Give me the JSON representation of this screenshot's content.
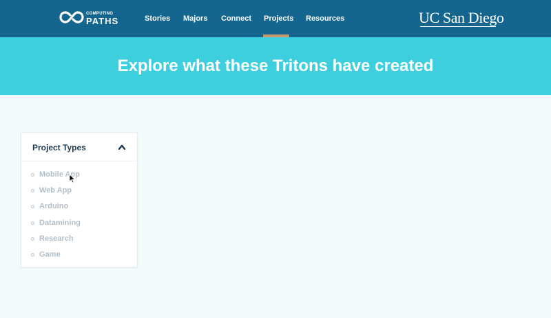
{
  "header": {
    "logo": {
      "top_text": "COMPUTING",
      "bottom_text": "PATHS",
      "icon": "infinity-loop-logo-icon"
    },
    "nav": [
      {
        "label": "Stories",
        "active": false
      },
      {
        "label": "Majors",
        "active": false
      },
      {
        "label": "Connect",
        "active": false
      },
      {
        "label": "Projects",
        "active": true
      },
      {
        "label": "Resources",
        "active": false
      }
    ],
    "brand": "UC San Diego",
    "colors": {
      "bar": "#15668f",
      "active_indicator": "#c69a6d"
    }
  },
  "hero": {
    "title": "Explore what these Tritons have created",
    "color": "#3ecfdf"
  },
  "filter": {
    "title": "Project Types",
    "expanded": true,
    "toggle_icon": "chevron-up-icon",
    "options": [
      {
        "label": "Mobile App",
        "icon": "radio-icon"
      },
      {
        "label": "Web App",
        "icon": "radio-icon"
      },
      {
        "label": "Arduino",
        "icon": "radio-icon"
      },
      {
        "label": "Datamining",
        "icon": "radio-icon"
      },
      {
        "label": "Research",
        "icon": "radio-icon"
      },
      {
        "label": "Game",
        "icon": "radio-icon"
      }
    ]
  }
}
